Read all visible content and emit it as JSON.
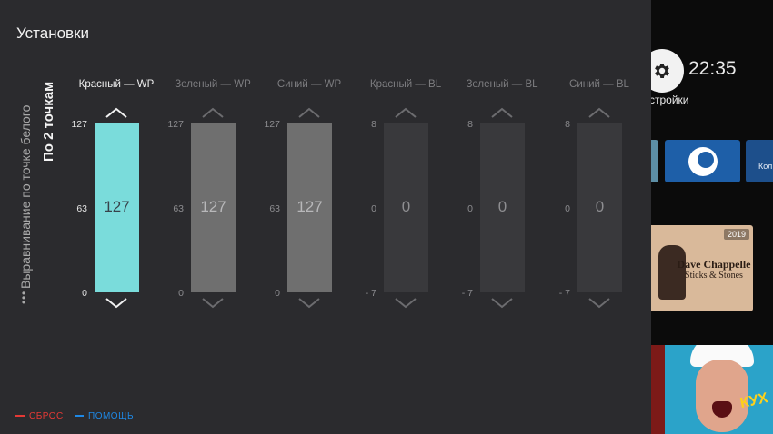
{
  "panel": {
    "title": "Установки",
    "side_label": "Выравнивание по точке белого",
    "side_sub_label": "По 2 точкам"
  },
  "columns": [
    {
      "label": "Красный — WP",
      "value": "127",
      "ticks": [
        "127",
        "63",
        "0"
      ],
      "active": true
    },
    {
      "label": "Зеленый — WP",
      "value": "127",
      "ticks": [
        "127",
        "63",
        "0"
      ],
      "active": false
    },
    {
      "label": "Синий — WP",
      "value": "127",
      "ticks": [
        "127",
        "63",
        "0"
      ],
      "active": false
    },
    {
      "label": "Красный — BL",
      "value": "0",
      "ticks": [
        "8",
        "0",
        "- 7"
      ],
      "active": false
    },
    {
      "label": "Зеленый — BL",
      "value": "0",
      "ticks": [
        "8",
        "0",
        "- 7"
      ],
      "active": false
    },
    {
      "label": "Синий — BL",
      "value": "0",
      "ticks": [
        "8",
        "0",
        "- 7"
      ],
      "active": false
    }
  ],
  "legend": {
    "reset_label": "СБРОС",
    "help_label": "ПОМОЩЬ",
    "reset_color": "#e53935",
    "help_color": "#1e88e5"
  },
  "home": {
    "clock": "22:35",
    "settings_label": "стройки",
    "tile_c_text": "Кол",
    "movie_title": "Dave Chappelle",
    "movie_subtitle": "Sticks & Stones",
    "movie_year": "2019",
    "show_logo": "КУХ"
  },
  "colors": {
    "panel_bg": "#2b2b2e",
    "active_bar": "#7adcdb",
    "wp_bar": "#6f6f6f",
    "bl_bar": "#39393c"
  }
}
